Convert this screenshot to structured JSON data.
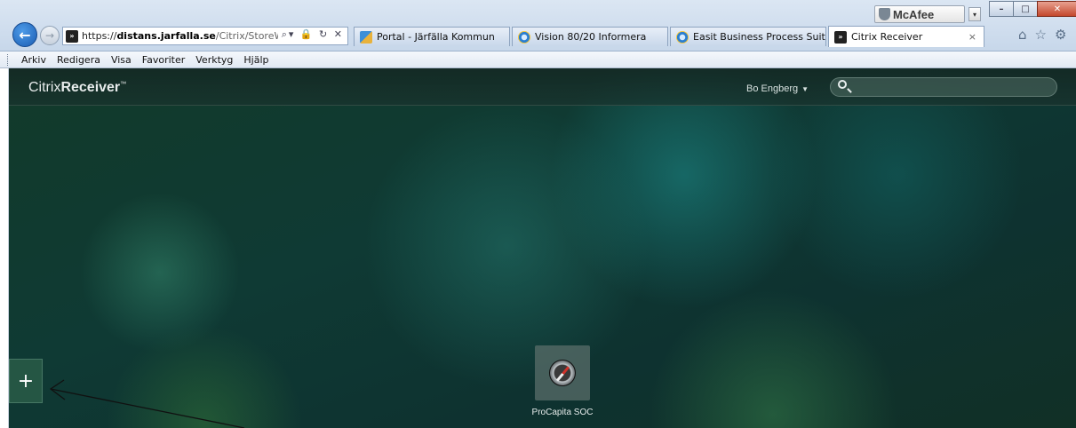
{
  "browser": {
    "addon_label": "McAfee",
    "address": {
      "scheme": "https://",
      "host": "distans.jarfalla.se",
      "path": "/Citrix/StoreWeb/"
    },
    "tabs": [
      {
        "label": "Portal - Järfälla Kommun",
        "icon": "portal-icon"
      },
      {
        "label": "Vision 80/20 Informera",
        "icon": "ie-icon"
      },
      {
        "label": "Easit Business Process Suite",
        "icon": "ie-icon"
      },
      {
        "label": "Citrix Receiver",
        "icon": "citrix-icon",
        "active": true
      }
    ],
    "menu": [
      "Arkiv",
      "Redigera",
      "Visa",
      "Favoriter",
      "Verktyg",
      "Hjälp"
    ]
  },
  "citrix": {
    "logo_light": "Citrix",
    "logo_bold": "Receiver",
    "user": "Bo Engberg",
    "search_placeholder": "",
    "add_label": "+",
    "apps": [
      {
        "label": "ProCapita SOC",
        "icon": "compass-icon"
      }
    ]
  },
  "colors": {
    "background": "#0f3a34",
    "ie_close": "#c3472c"
  }
}
